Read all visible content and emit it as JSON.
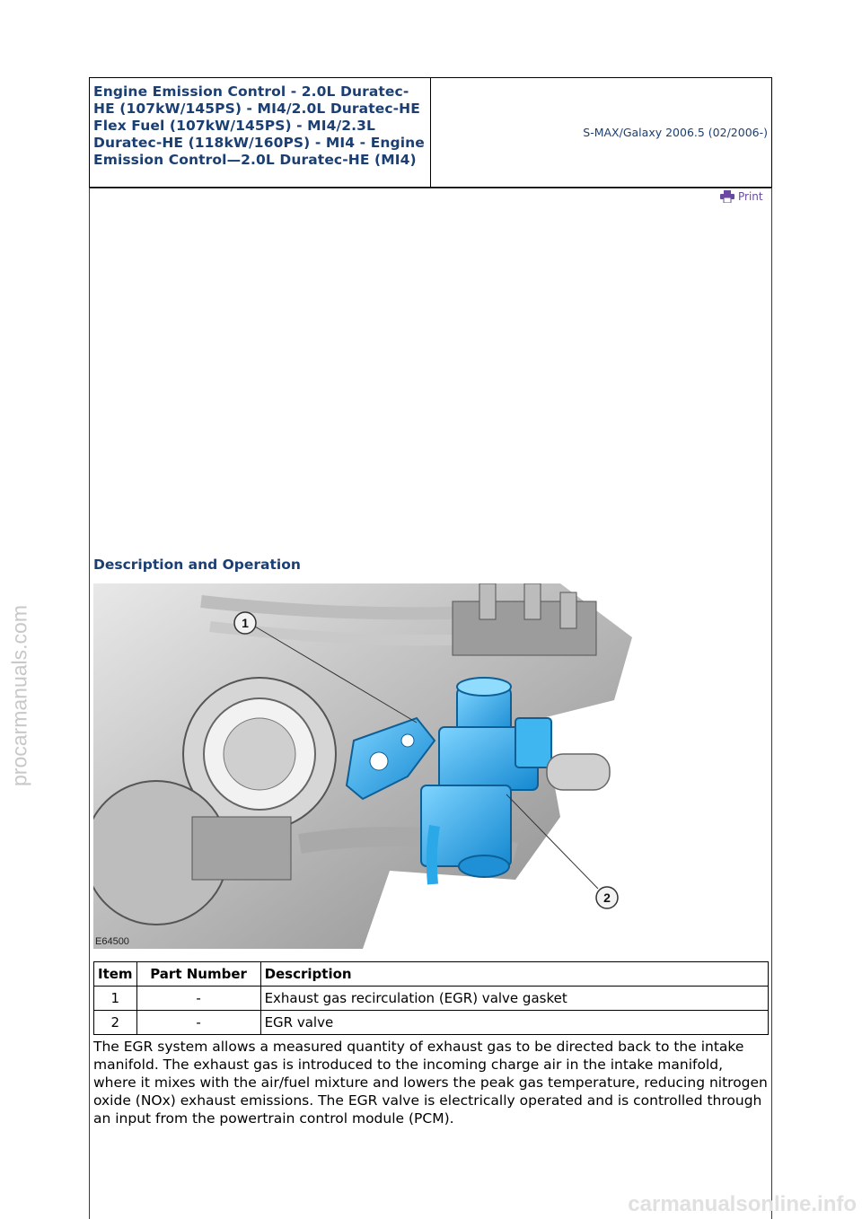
{
  "header": {
    "title": "Engine Emission Control - 2.0L Duratec-HE (107kW/145PS) - MI4/2.0L Duratec-HE Flex Fuel (107kW/145PS) - MI4/2.3L Duratec-HE (118kW/160PS) - MI4 - Engine Emission Control—2.0L Duratec-HE (MI4)",
    "vehicle": "S-MAX/Galaxy 2006.5 (02/2006-)"
  },
  "print": {
    "label": "Print",
    "icon": "printer-icon"
  },
  "section": {
    "title": "Description and Operation"
  },
  "figure": {
    "label": "E64500",
    "callouts": [
      "1",
      "2"
    ]
  },
  "parts_table": {
    "headers": [
      "Item",
      "Part Number",
      "Description"
    ],
    "rows": [
      {
        "item": "1",
        "part_number": "-",
        "description": "Exhaust gas recirculation (EGR) valve gasket"
      },
      {
        "item": "2",
        "part_number": "-",
        "description": "EGR valve"
      }
    ]
  },
  "body": {
    "paragraph": "The EGR system allows a measured quantity of exhaust gas to be directed back to the intake manifold. The exhaust gas is introduced to the incoming charge air in the intake manifold, where it mixes with the air/fuel mixture and lowers the peak gas temperature, reducing nitrogen oxide (NOx) exhaust emissions. The EGR valve is electrically operated and is controlled through an input from the powertrain control module (PCM)."
  },
  "watermarks": {
    "left": "procarmanuals.com",
    "bottom": "carmanualsonline.info"
  },
  "colors": {
    "heading": "#1b3f73",
    "highlight_part": "#2aa8e8"
  }
}
